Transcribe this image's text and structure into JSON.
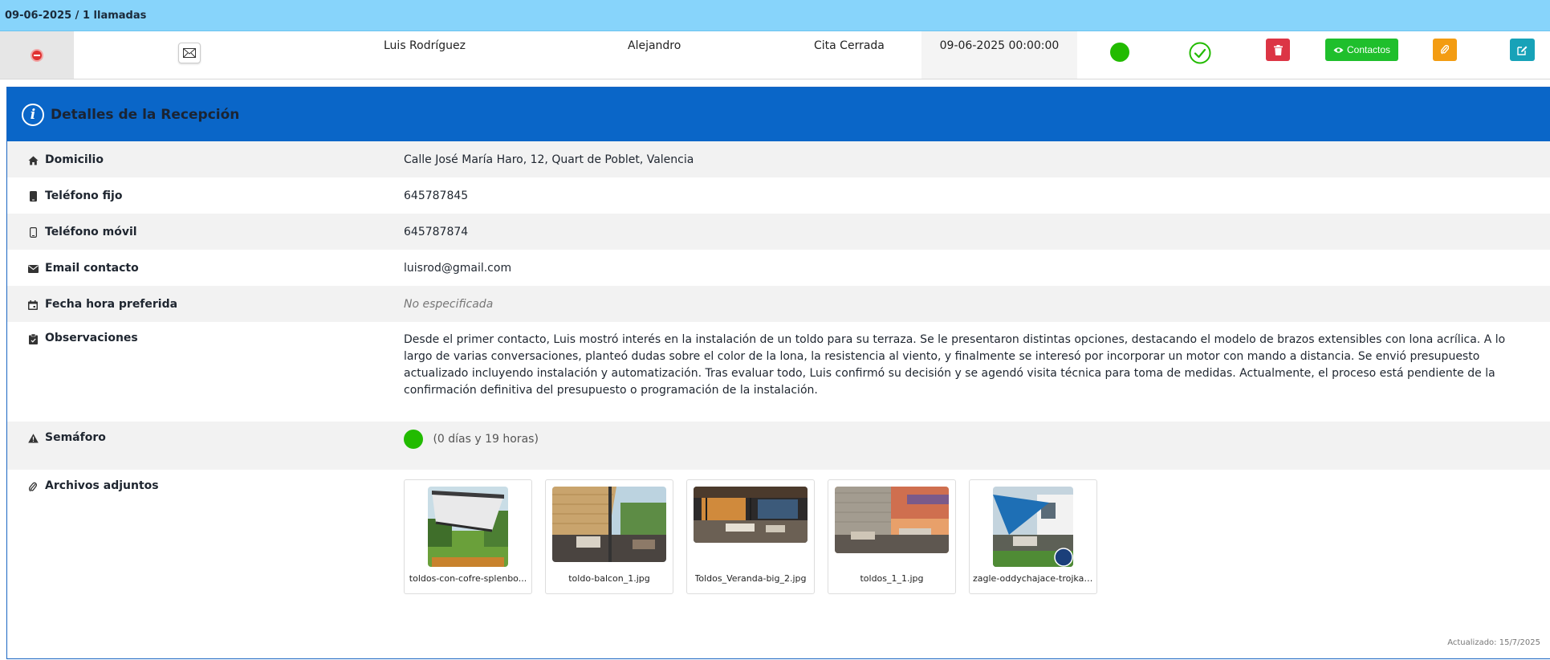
{
  "group_header": {
    "title": "09-06-2025 / 1 llamadas"
  },
  "summary": {
    "client": "Luis Rodríguez",
    "agent": "Alejandro",
    "status": "Cita Cerrada",
    "datetime": "09-06-2025 00:00:00",
    "contacts_label": "Contactos",
    "status_color": "#22bb00"
  },
  "details": {
    "title": "Detalles de la Recepción",
    "rows": [
      {
        "label": "Domicilio",
        "value": "Calle José María Haro, 12, Quart de Poblet, Valencia",
        "icon": "home-icon"
      },
      {
        "label": "Teléfono fijo",
        "value": "645787845",
        "icon": "phone-icon"
      },
      {
        "label": "Teléfono móvil",
        "value": "645787874",
        "icon": "mobile-icon"
      },
      {
        "label": "Email contacto",
        "value": "luisrod@gmail.com",
        "icon": "envelope-icon"
      },
      {
        "label": "Fecha hora preferida",
        "value": "No especificada",
        "icon": "calendar-icon"
      },
      {
        "label": "Observaciones",
        "value": "Desde el primer contacto, Luis mostró interés en la instalación de un toldo para su terraza. Se le presentaron distintas opciones, destacando el modelo de brazos extensibles con lona acrílica. A lo largo de varias conversaciones, planteó dudas sobre el color de la lona, la resistencia al viento, y finalmente se interesó por incorporar un motor con mando a distancia. Se envió presupuesto actualizado incluyendo instalación y automatización. Tras evaluar todo, Luis confirmó su decisión y se agendó visita técnica para toma de medidas. Actualmente, el proceso está pendiente de la confirmación definitiva del presupuesto o programación de la instalación.",
        "icon": "clipboard-icon"
      },
      {
        "label": "Semáforo",
        "value": "(0 días y 19 horas)",
        "icon": "warning-icon"
      },
      {
        "label": "Archivos adjuntos",
        "icon": "paperclip-icon"
      }
    ],
    "attachments": [
      {
        "name": "toldos-con-cofre-splenbo..."
      },
      {
        "name": "toldo-balcon_1.jpg"
      },
      {
        "name": "Toldos_Veranda-big_2.jpg"
      },
      {
        "name": "toldos_1_1.jpg"
      },
      {
        "name": "zagle-oddychajace-trojkat..."
      }
    ],
    "updated": "Actualizado: 15/7/2025"
  }
}
